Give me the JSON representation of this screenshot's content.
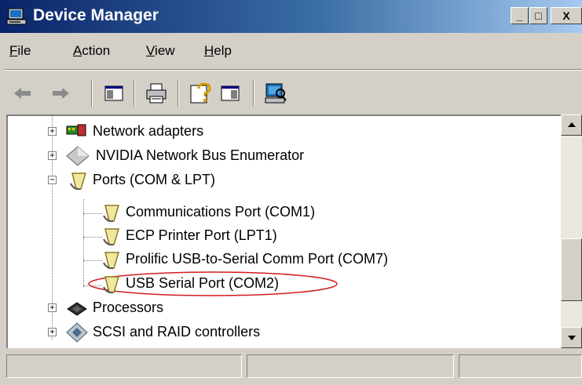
{
  "window": {
    "title": "Device Manager",
    "controls": {
      "minimize": "_",
      "maximize": "□",
      "close": "X"
    }
  },
  "menu": {
    "items": [
      {
        "hotkey": "F",
        "rest": "ile"
      },
      {
        "hotkey": "A",
        "rest": "ction"
      },
      {
        "hotkey": "V",
        "rest": "iew"
      },
      {
        "hotkey": "H",
        "rest": "elp"
      }
    ]
  },
  "toolbar": {
    "buttons": [
      "back-icon",
      "forward-icon",
      "show-hide-console-tree-icon",
      "print-icon",
      "help-icon",
      "show-hide-action-pane-icon",
      "scan-hardware-icon"
    ]
  },
  "tree": {
    "items": [
      {
        "label": "Network adapters",
        "icon": "network-adapter-icon",
        "expander": "+"
      },
      {
        "label": "NVIDIA Network Bus Enumerator",
        "icon": "diamond-device-icon",
        "expander": "+"
      },
      {
        "label": "Ports (COM & LPT)",
        "icon": "port-icon",
        "expander": "−"
      },
      {
        "label": "Communications Port (COM1)",
        "icon": "port-icon"
      },
      {
        "label": "ECP Printer Port (LPT1)",
        "icon": "port-icon"
      },
      {
        "label": "Prolific USB-to-Serial Comm Port (COM7)",
        "icon": "port-icon"
      },
      {
        "label": "USB Serial Port (COM2)",
        "icon": "port-icon",
        "highlighted": true
      },
      {
        "label": "Processors",
        "icon": "processor-icon",
        "expander": "+"
      },
      {
        "label": "SCSI and RAID controllers",
        "icon": "scsi-controller-icon",
        "expander": "+"
      }
    ]
  },
  "colors": {
    "titlebar_start": "#0a246a",
    "titlebar_end": "#a6caf0",
    "highlight_ellipse": "#d21c1c"
  }
}
